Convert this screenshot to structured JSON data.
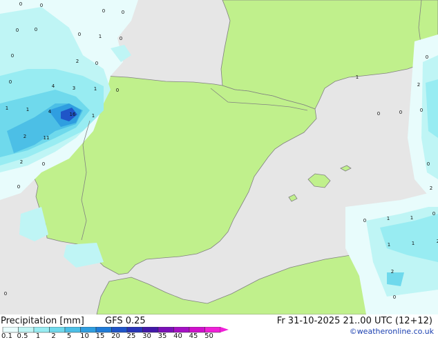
{
  "footer": {
    "title": "Precipitation [mm]",
    "model": "GFS 0.25",
    "datetime": "Fr 31-10-2025 21..00 UTC (12+12)",
    "credit": "©weatheronline.co.uk"
  },
  "legend": {
    "ticks": [
      "0.1",
      "0.5",
      "1",
      "2",
      "5",
      "10",
      "15",
      "20",
      "25",
      "30",
      "35",
      "40",
      "45",
      "50"
    ],
    "colors": [
      "#e8fcfc",
      "#bff5f5",
      "#98ecf2",
      "#6fd9ec",
      "#4cbfe6",
      "#2f9ee0",
      "#1f7bd8",
      "#1f55c8",
      "#2834b8",
      "#4218a8",
      "#7a10b8",
      "#a510c4",
      "#d010cc",
      "#f020d8"
    ]
  },
  "colors": {
    "sea": "#e6e6e6",
    "land": "#c0f08c",
    "border": "#808080"
  },
  "map_labels": [
    "0",
    "0",
    "0",
    "0",
    "0",
    "0",
    "1",
    "0",
    "0",
    "2",
    "0",
    "0",
    "0",
    "4",
    "3",
    "1",
    "0",
    "1",
    "1",
    "4",
    "16",
    "1",
    "2",
    "11",
    "2",
    "0",
    "0",
    "1",
    "0",
    "0",
    "0",
    "2",
    "0",
    "0",
    "2",
    "0",
    "1",
    "1",
    "0",
    "1",
    "1",
    "2",
    "2",
    "0",
    "0"
  ]
}
